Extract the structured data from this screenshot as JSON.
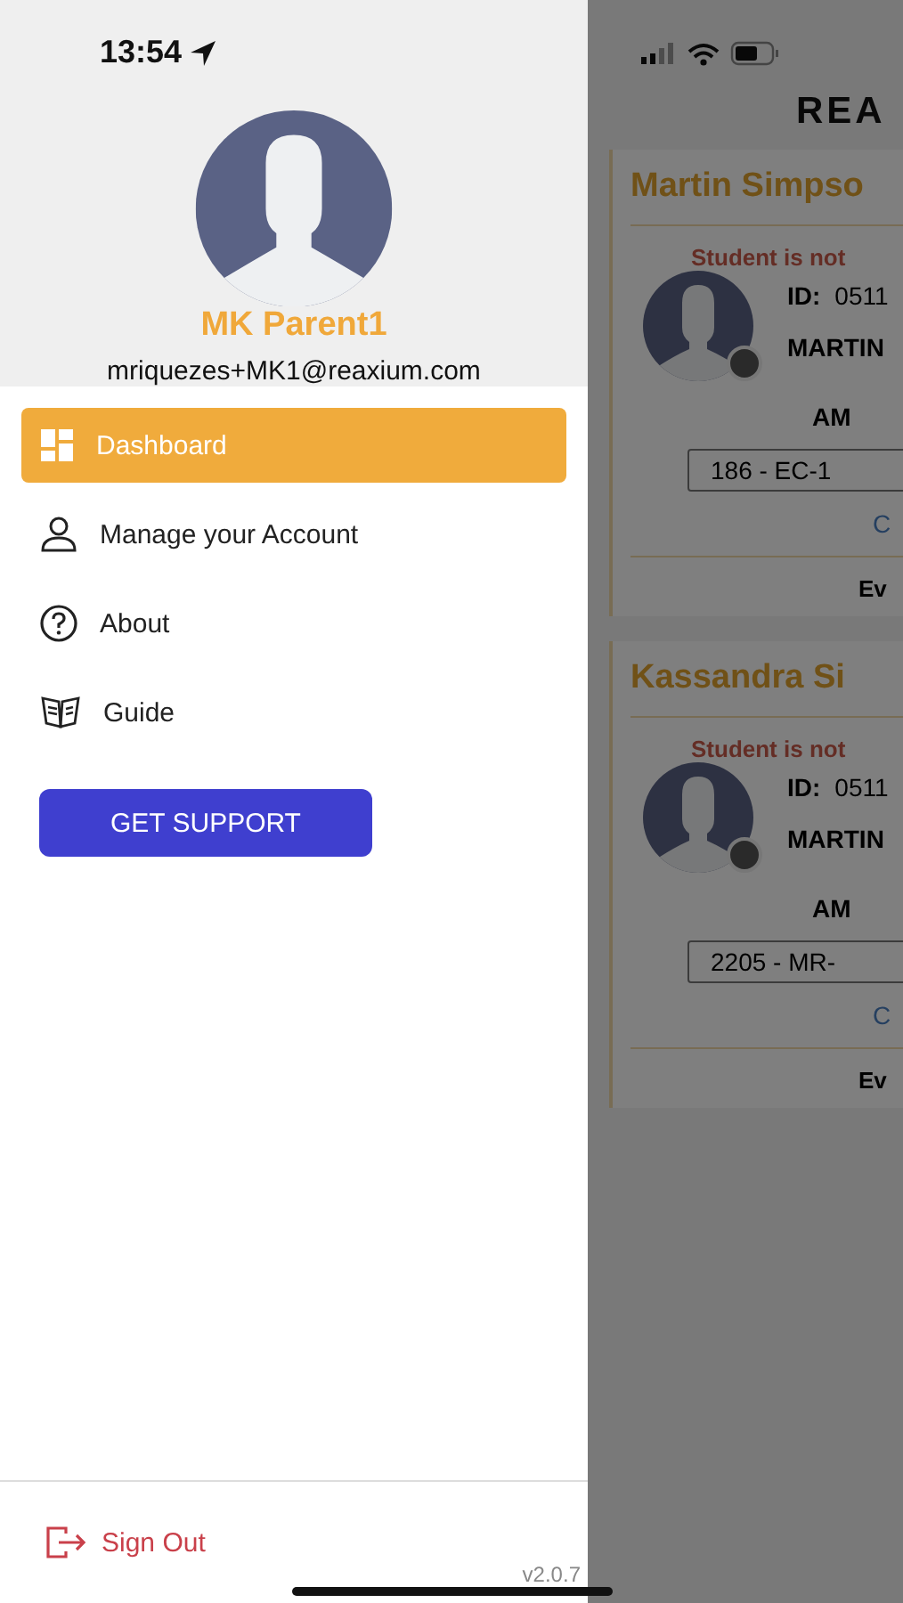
{
  "status_bar": {
    "time": "13:54"
  },
  "profile": {
    "name": "MK Parent1",
    "email": "mriquezes+MK1@reaxium.com"
  },
  "menu": [
    {
      "label": "Dashboard",
      "kind": "dashboard",
      "selected": true
    },
    {
      "label": "Manage your Account",
      "kind": "account",
      "selected": false
    },
    {
      "label": "About",
      "kind": "about",
      "selected": false
    },
    {
      "label": "Guide",
      "kind": "guide",
      "selected": false
    }
  ],
  "support_button": "GET SUPPORT",
  "sign_out": "Sign Out",
  "version": "v2.0.7",
  "background": {
    "title": "REA",
    "cards": [
      {
        "name": "Martin Simpso",
        "status": "Student is not",
        "id_label": "ID:",
        "id": "0511",
        "student": "MARTIN",
        "session": "AM",
        "route": "186 - EC-1",
        "link": "C",
        "footer": "Ev"
      },
      {
        "name": "Kassandra Si",
        "status": "Student is not",
        "id_label": "ID:",
        "id": "0511",
        "student": "MARTIN",
        "session": "AM",
        "route": "2205 - MR-",
        "link": "C",
        "footer": "Ev"
      }
    ]
  }
}
